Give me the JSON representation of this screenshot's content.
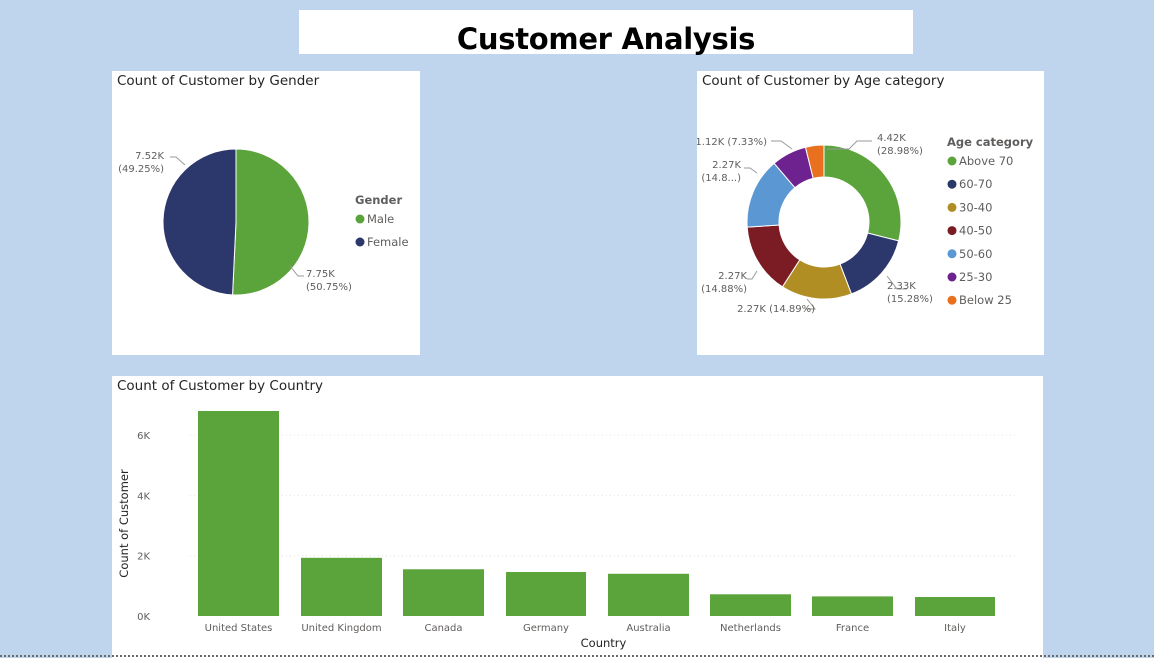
{
  "title": "Customer Analysis",
  "colors": {
    "background": "#bfd5ee",
    "male": "#5ba33b",
    "female": "#2c376b",
    "bar": "#5ba33b"
  },
  "chart_data": [
    {
      "type": "pie",
      "title": "Count of Customer by Gender",
      "legend_title": "Gender",
      "legend_position": "right",
      "slices": [
        {
          "name": "Male",
          "value": 7750,
          "label": "7.75K",
          "pct": "(50.75%)",
          "color": "#5ba33b"
        },
        {
          "name": "Female",
          "value": 7520,
          "label": "7.52K",
          "pct": "(49.25%)",
          "color": "#2c376b"
        }
      ]
    },
    {
      "type": "pie",
      "subtype": "donut",
      "title": "Count of Customer by Age category",
      "legend_title": "Age category",
      "legend_position": "right",
      "slices": [
        {
          "name": "Above 70",
          "value": 4420,
          "label": "4.42K",
          "pct": "(28.98%)",
          "color": "#5ba33b"
        },
        {
          "name": "60-70",
          "value": 2330,
          "label": "2.33K",
          "pct": "(15.28%)",
          "color": "#2c376b"
        },
        {
          "name": "30-40",
          "value": 2270,
          "label": "2.27K",
          "pct": "(14.89%)",
          "color": "#b08e24"
        },
        {
          "name": "40-50",
          "value": 2270,
          "label": "2.27K",
          "pct": "(14.88%)",
          "color": "#7b1c24"
        },
        {
          "name": "50-60",
          "value": 2270,
          "label": "2.27K",
          "pct": "(14.8...)",
          "color": "#5b97d2"
        },
        {
          "name": "25-30",
          "value": 1120,
          "label": "1.12K",
          "pct": "(7.33%)",
          "color": "#6e2290"
        },
        {
          "name": "Below 25",
          "value": 590,
          "label": "",
          "pct": "",
          "color": "#e8701e"
        }
      ]
    },
    {
      "type": "bar",
      "title": "Count of Customer by Country",
      "xlabel": "Country",
      "ylabel": "Count of Customer",
      "ylim": [
        0,
        6800
      ],
      "yticks": [
        0,
        2000,
        4000,
        6000
      ],
      "ytick_labels": [
        "0K",
        "2K",
        "4K",
        "6K"
      ],
      "grid": true,
      "categories": [
        "United States",
        "United Kingdom",
        "Canada",
        "Germany",
        "Australia",
        "Netherlands",
        "France",
        "Italy"
      ],
      "values": [
        6800,
        1930,
        1550,
        1460,
        1400,
        720,
        650,
        630
      ]
    }
  ]
}
